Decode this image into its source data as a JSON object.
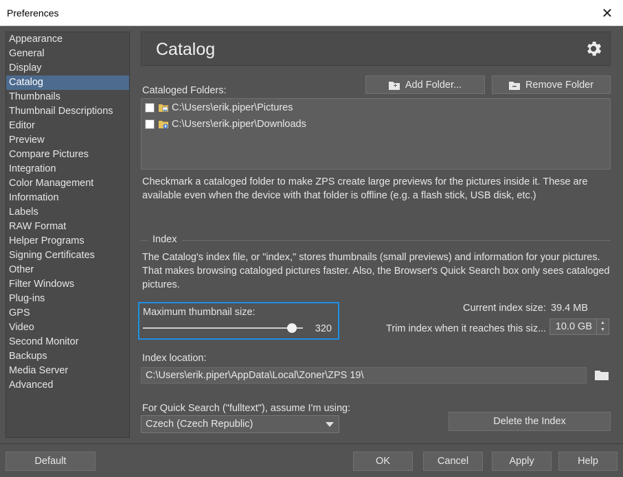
{
  "window": {
    "title": "Preferences",
    "close_glyph": "✕"
  },
  "sidebar": {
    "items": [
      {
        "label": "Appearance"
      },
      {
        "label": "General"
      },
      {
        "label": "Display"
      },
      {
        "label": "Catalog",
        "selected": true
      },
      {
        "label": "Thumbnails"
      },
      {
        "label": "Thumbnail Descriptions"
      },
      {
        "label": "Editor"
      },
      {
        "label": "Preview"
      },
      {
        "label": "Compare Pictures"
      },
      {
        "label": "Integration"
      },
      {
        "label": "Color Management"
      },
      {
        "label": "Information"
      },
      {
        "label": "Labels"
      },
      {
        "label": "RAW Format"
      },
      {
        "label": "Helper Programs"
      },
      {
        "label": "Signing Certificates"
      },
      {
        "label": "Other"
      },
      {
        "label": "Filter Windows"
      },
      {
        "label": "Plug-ins"
      },
      {
        "label": "GPS"
      },
      {
        "label": "Video"
      },
      {
        "label": "Second Monitor"
      },
      {
        "label": "Backups"
      },
      {
        "label": "Media Server"
      },
      {
        "label": "Advanced"
      }
    ]
  },
  "header": {
    "title": "Catalog",
    "icon": "gear-icon"
  },
  "folders": {
    "label": "Cataloged Folders:",
    "add_label": "Add Folder...",
    "remove_label": "Remove Folder",
    "items": [
      {
        "path": "C:\\Users\\erik.piper\\Pictures",
        "checked": false,
        "icon": "pictures-folder-icon"
      },
      {
        "path": "C:\\Users\\erik.piper\\Downloads",
        "checked": false,
        "icon": "downloads-folder-icon"
      }
    ],
    "help_text": "Checkmark a cataloged folder to make ZPS create large previews for the pictures inside it. These are available even when the device with that folder is offline (e.g. a flash stick, USB disk, etc.)"
  },
  "index": {
    "section_title": "Index",
    "description": "The Catalog's index file, or \"index,\" stores thumbnails (small previews) and information for your pictures. That makes browsing cataloged pictures faster. Also, the Browser's Quick Search box only sees cataloged pictures.",
    "thumb_label": "Maximum thumbnail size:",
    "thumb_value": "320",
    "thumb_fraction": 0.96,
    "current_size_label": "Current index size:",
    "current_size_value": "39.4 MB",
    "trim_label": "Trim index when it reaches this siz...",
    "trim_value": "10.0 GB",
    "location_label": "Index location:",
    "location_value": "C:\\Users\\erik.piper\\AppData\\Local\\Zoner\\ZPS 19\\",
    "quicksearch_label": "For Quick Search (\"fulltext\"), assume I'm using:",
    "quicksearch_value": "Czech (Czech Republic)",
    "delete_label": "Delete the Index"
  },
  "footer": {
    "default_label": "Default",
    "ok_label": "OK",
    "cancel_label": "Cancel",
    "apply_label": "Apply",
    "help_label": "Help"
  },
  "colors": {
    "accent": "#1e90e6",
    "selection": "#4d6b8f",
    "background": "#535353"
  }
}
